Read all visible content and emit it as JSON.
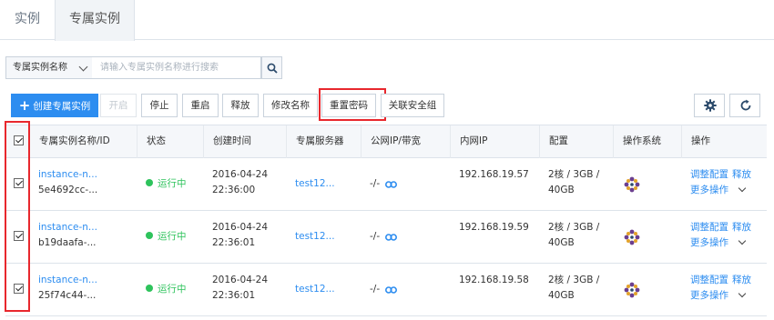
{
  "tabs": [
    "实例",
    "专属实例"
  ],
  "search": {
    "field": "专属实例名称",
    "placeholder": "请输入专属实例名称进行搜索"
  },
  "toolbar": {
    "create": "创建专属实例",
    "start": "开启",
    "stop": "停止",
    "restart": "重启",
    "release": "释放",
    "rename": "修改名称",
    "reset_password": "重置密码",
    "bind_sg": "关联安全组"
  },
  "table": {
    "headers": [
      "专属实例名称/ID",
      "状态",
      "创建时间",
      "专属服务器",
      "公网IP/带宽",
      "内网IP",
      "配置",
      "操作系统",
      "操作"
    ],
    "rows": [
      {
        "name": "instance-n...",
        "id": "5e4692cc-...",
        "status": "运行中",
        "date": "2016-04-24",
        "time": "22:36:00",
        "server": "test12...",
        "public_ip": "-/-",
        "private_ip": "192.168.19.57",
        "config_1": "2核 / 3GB /",
        "config_2": "40GB",
        "op_adjust": "调整配置",
        "op_release": "释放",
        "op_more": "更多操作"
      },
      {
        "name": "instance-n...",
        "id": "b19daafa-...",
        "status": "运行中",
        "date": "2016-04-24",
        "time": "22:36:01",
        "server": "test12...",
        "public_ip": "-/-",
        "private_ip": "192.168.19.59",
        "config_1": "2核 / 3GB /",
        "config_2": "40GB",
        "op_adjust": "调整配置",
        "op_release": "释放",
        "op_more": "更多操作"
      },
      {
        "name": "instance-n...",
        "id": "25f74c44-...",
        "status": "运行中",
        "date": "2016-04-24",
        "time": "22:36:01",
        "server": "test12...",
        "public_ip": "-/-",
        "private_ip": "192.168.19.58",
        "config_1": "2核 / 3GB /",
        "config_2": "40GB",
        "op_adjust": "调整配置",
        "op_release": "释放",
        "op_more": "更多操作"
      }
    ]
  },
  "colors": {
    "accent": "#2d8df0",
    "running": "#2ec35c",
    "highlight": "#e8272d"
  }
}
